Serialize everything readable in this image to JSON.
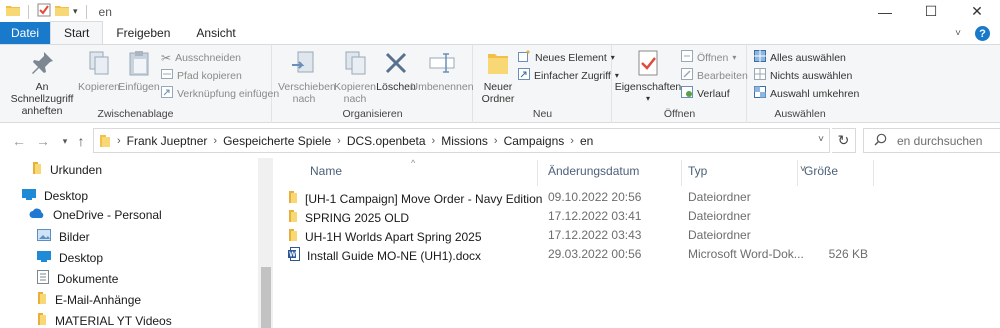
{
  "window": {
    "title": "en",
    "controls": {
      "minimize": "—",
      "maximize": "☐",
      "close": "✕"
    }
  },
  "ribbon_tabs": [
    "Datei",
    "Start",
    "Freigeben",
    "Ansicht"
  ],
  "ribbon": {
    "clipboard": {
      "label": "Zwischenablage",
      "pin": "An Schnellzugriff anheften",
      "copy": "Kopieren",
      "paste": "Einfügen",
      "cut": "Ausschneiden",
      "copy_path": "Pfad kopieren",
      "paste_shortcut": "Verknüpfung einfügen"
    },
    "organize": {
      "label": "Organisieren",
      "move_to": "Verschieben nach",
      "copy_to": "Kopieren nach",
      "delete": "Löschen",
      "rename": "Umbenennen"
    },
    "new": {
      "label": "Neu",
      "new_folder": "Neuer Ordner",
      "new_item": "Neues Element",
      "easy_access": "Einfacher Zugriff"
    },
    "open": {
      "label": "Öffnen",
      "properties": "Eigenschaften",
      "open": "Öffnen",
      "edit": "Bearbeiten",
      "history": "Verlauf"
    },
    "select": {
      "label": "Auswählen",
      "select_all": "Alles auswählen",
      "select_none": "Nichts auswählen",
      "invert": "Auswahl umkehren"
    }
  },
  "address": {
    "crumbs": [
      "Frank Jueptner",
      "Gespeicherte Spiele",
      "DCS.openbeta",
      "Missions",
      "Campaigns",
      "en"
    ],
    "search_placeholder": "en durchsuchen"
  },
  "nav_pane": [
    {
      "label": "Urkunden",
      "icon": "folder-icon"
    },
    {
      "label": "Desktop",
      "icon": "desktop-icon"
    },
    {
      "label": "OneDrive - Personal",
      "icon": "cloud-icon"
    },
    {
      "label": "Bilder",
      "icon": "pictures-icon"
    },
    {
      "label": "Desktop",
      "icon": "desktop-icon"
    },
    {
      "label": "Dokumente",
      "icon": "documents-icon"
    },
    {
      "label": "E-Mail-Anhänge",
      "icon": "folder-icon"
    },
    {
      "label": "MATERIAL YT Videos",
      "icon": "folder-icon"
    }
  ],
  "columns": [
    "Name",
    "Änderungsdatum",
    "Typ",
    "Größe"
  ],
  "files": [
    {
      "name": "[UH-1 Campaign] Move Order - Navy Edition (b...",
      "date": "09.10.2022 20:56",
      "type": "Dateiordner",
      "size": "",
      "icon": "folder"
    },
    {
      "name": "SPRING 2025 OLD",
      "date": "17.12.2022 03:41",
      "type": "Dateiordner",
      "size": "",
      "icon": "folder"
    },
    {
      "name": "UH-1H Worlds Apart Spring 2025",
      "date": "17.12.2022 03:43",
      "type": "Dateiordner",
      "size": "",
      "icon": "folder"
    },
    {
      "name": "Install Guide MO-NE (UH1).docx",
      "date": "29.03.2022 00:56",
      "type": "Microsoft Word-Dok...",
      "size": "526 KB",
      "icon": "word"
    }
  ],
  "colors": {
    "accent": "#1979ca",
    "folder": "#f2c04a",
    "ribbon_bg": "#f5f6f7"
  }
}
